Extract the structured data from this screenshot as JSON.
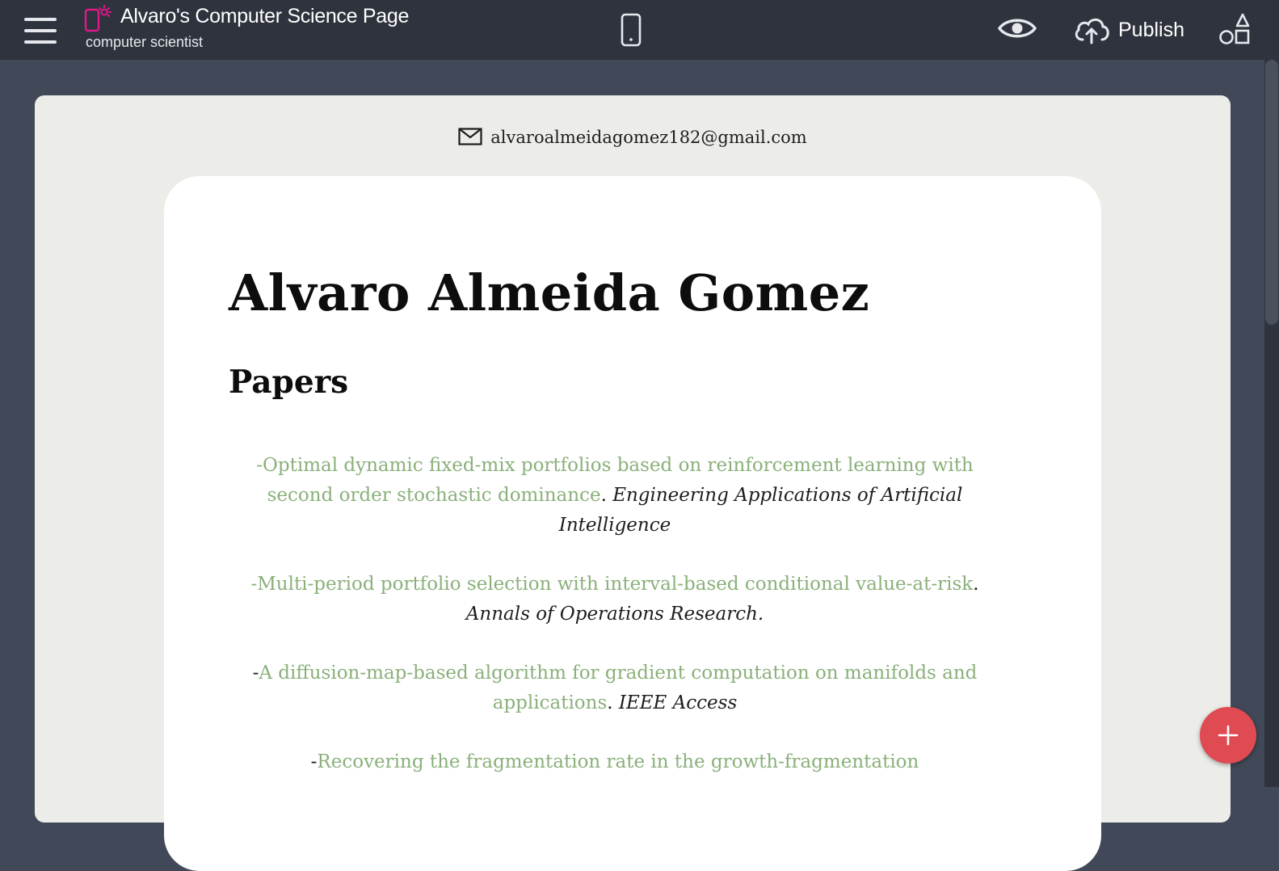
{
  "header": {
    "title": "Alvaro's Computer Science Page",
    "subtitle": "computer scientist",
    "publish_label": "Publish",
    "accent_color": "#e0198b",
    "icons": [
      "menu-icon",
      "site-device-icon",
      "mobile-preview-icon",
      "eye-icon",
      "cloud-upload-icon",
      "shapes-icon"
    ]
  },
  "page": {
    "email": "alvaroalmeidagomez182@gmail.com",
    "name": "Alvaro Almeida Gomez",
    "section_title": "Papers",
    "papers": [
      {
        "prefix": "-",
        "title": "Optimal dynamic fixed-mix portfolios based on reinforcement learning with second order stochastic dominance",
        "sep": ". ",
        "venue": "Engineering Applications of Artificial Intelligence"
      },
      {
        "prefix": "-",
        "title": "Multi-period portfolio selection with interval-based conditional value-at-risk",
        "sep": ". ",
        "venue": "Annals of Operations Research."
      },
      {
        "prefix": "-",
        "title": "A diffusion-map-based algorithm for gradient computation on manifolds and applications",
        "sep": ". ",
        "venue": "IEEE Access"
      },
      {
        "prefix": "-",
        "title": "Recovering the fragmentation rate in the growth-fragmentation",
        "sep": "",
        "venue": ""
      }
    ],
    "link_color": "#8ab07a"
  },
  "fab": {
    "icon": "plus-icon",
    "color": "#e04a52"
  }
}
